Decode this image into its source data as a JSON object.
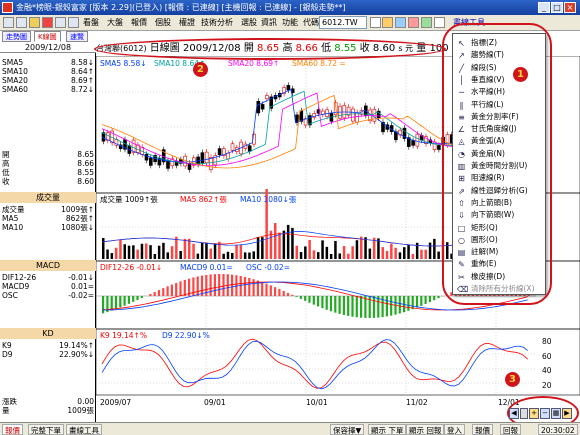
{
  "window": {
    "title": "金融*榜眼-銀殼富家 [版本 2.29](已登入) [報價 : 已連線] [主機回報 : 已連線] - [銀殼走勢**]",
    "buttons": [
      "_",
      "□",
      "×"
    ]
  },
  "menubar": {
    "items": [
      "看盤",
      "大盤",
      "報價",
      "個股",
      "權證",
      "技術分析",
      "選股",
      "資訊",
      "功能"
    ],
    "code_label": "代碼",
    "code_value": "6012.TW",
    "drawtool_label": "畫線工具"
  },
  "tabs": [
    "走勢圖",
    "K線圖",
    "速覽"
  ],
  "left_panel": {
    "date": "2009/12/08",
    "ma_rows": [
      {
        "label": "SMA5",
        "value": "8.58",
        "arrow": "↓",
        "color": "#0040ff"
      },
      {
        "label": "SMA10",
        "value": "8.64",
        "arrow": "↑",
        "color": "#00a0a0"
      },
      {
        "label": "SMA20",
        "value": "8.69",
        "arrow": "↑",
        "color": "#ff00ff"
      },
      {
        "label": "SMA60",
        "value": "8.72",
        "arrow": "↓",
        "color": "#ff8000"
      }
    ],
    "ohlc": [
      {
        "label": "開",
        "value": "8.65"
      },
      {
        "label": "高",
        "value": "8.66"
      },
      {
        "label": "低",
        "value": "8.55"
      },
      {
        "label": "收",
        "value": "8.60"
      }
    ],
    "volume_head": "成交量",
    "volume_rows": [
      {
        "label": "成交量",
        "value": "1009張",
        "arrow": "↑",
        "color": "#000000"
      },
      {
        "label": "MA5",
        "value": "862張",
        "arrow": "↑",
        "color": "#ff0000"
      },
      {
        "label": "MA10",
        "value": "1080張",
        "arrow": "↓",
        "color": "#0040ff"
      }
    ],
    "macd_head": "MACD",
    "macd_rows": [
      {
        "label": "DIF12-26",
        "value": "-0.01",
        "arrow": "↓",
        "color": "#ff0000"
      },
      {
        "label": "MACD9",
        "value": "0.01",
        "arrow": "=",
        "color": "#0040ff"
      },
      {
        "label": "OSC",
        "value": "-0.02",
        "arrow": "=",
        "color": "#0040ff"
      }
    ],
    "kd_head": "KD",
    "kd_rows": [
      {
        "label": "K9",
        "value": "19.14%",
        "arrow": "↑",
        "color": "#ff0000"
      },
      {
        "label": "D9",
        "value": "22.90%",
        "arrow": "↓",
        "color": "#0040ff"
      }
    ],
    "bottom_rows": [
      {
        "label": "漲跌",
        "value": "0.00"
      },
      {
        "label": "量",
        "value": "1009張"
      }
    ]
  },
  "stock_bar": {
    "name": "台灣聯(6012)",
    "period": "日線圖",
    "date": "2009/12/08",
    "open_label": "開",
    "open": "8.65",
    "high_label": "高",
    "high": "8.66",
    "low_label": "低",
    "low": "8.55",
    "close_label": "收",
    "close": "8.60",
    "unit": "s 元",
    "volume_label": "量",
    "volume": "100"
  },
  "chart": {
    "price_legend": [
      {
        "text": "SMA5 8.58↓",
        "color": "#0040ff"
      },
      {
        "text": "SMA10 8.64↑",
        "color": "#00a0a0"
      },
      {
        "text": "SMA20 8.69↑",
        "color": "#ff00ff"
      },
      {
        "text": "SMA60 8.72 =",
        "color": "#ff8000"
      }
    ],
    "volume_legend": [
      {
        "text": "成交量 1009↑張",
        "color": "#000000"
      },
      {
        "text": "MA5 862↑張",
        "color": "#ff0000"
      },
      {
        "text": "MA10 1080↓張",
        "color": "#0040ff"
      }
    ],
    "macd_legend": [
      {
        "text": "DIF12-26 -0.01↓",
        "color": "#ff0000"
      },
      {
        "text": "MACD9 0.01=",
        "color": "#0040ff"
      },
      {
        "text": "OSC -0.02=",
        "color": "#0040ff"
      }
    ],
    "kd_legend": [
      {
        "text": "K9 19.14↑%",
        "color": "#ff0000"
      },
      {
        "text": "D9 22.90↓%",
        "color": "#0040ff"
      }
    ],
    "kd_axis": [
      "80",
      "60",
      "40",
      "20"
    ],
    "x_labels": [
      "2009/07",
      "09/01",
      "10/01",
      "11/02",
      "12/01"
    ]
  },
  "popup_menu": {
    "title": "畫線工具",
    "items": [
      {
        "icon": "↖",
        "label": "指標(Z)",
        "disabled": false,
        "icon_name": "pointer-icon"
      },
      {
        "icon": "↗",
        "label": "趨勢線(T)",
        "disabled": false,
        "icon_name": "trendline-icon"
      },
      {
        "icon": "╱",
        "label": "線段(S)",
        "disabled": false,
        "icon_name": "segment-icon"
      },
      {
        "icon": "│",
        "label": "垂直線(V)",
        "disabled": false,
        "icon_name": "vertical-line-icon"
      },
      {
        "icon": "─",
        "label": "水平線(H)",
        "disabled": false,
        "icon_name": "horizontal-line-icon"
      },
      {
        "icon": "∥",
        "label": "平行線(L)",
        "disabled": false,
        "icon_name": "parallel-line-icon"
      },
      {
        "icon": "≡",
        "label": "黃金分割率(F)",
        "disabled": false,
        "icon_name": "fibonacci-icon"
      },
      {
        "icon": "∠",
        "label": "甘氏角度線(J)",
        "disabled": false,
        "icon_name": "gann-angle-icon"
      },
      {
        "icon": "◬",
        "label": "黃金弧(A)",
        "disabled": false,
        "icon_name": "golden-arc-icon"
      },
      {
        "icon": "◔",
        "label": "黃金扇(N)",
        "disabled": false,
        "icon_name": "golden-fan-icon"
      },
      {
        "icon": "▥",
        "label": "黃金時間分割(U)",
        "disabled": false,
        "icon_name": "golden-time-icon"
      },
      {
        "icon": "⊞",
        "label": "阻速線(R)",
        "disabled": false,
        "icon_name": "speed-resistance-icon"
      },
      {
        "icon": "⇗",
        "label": "線性迴歸分析(G)",
        "disabled": false,
        "icon_name": "regression-icon"
      },
      {
        "icon": "⇧",
        "label": "向上箭頭(B)",
        "disabled": false,
        "icon_name": "arrow-up-icon"
      },
      {
        "icon": "⇩",
        "label": "向下箭頭(W)",
        "disabled": false,
        "icon_name": "arrow-down-icon"
      },
      {
        "icon": "□",
        "label": "矩形(Q)",
        "disabled": false,
        "icon_name": "rectangle-icon"
      },
      {
        "icon": "○",
        "label": "圓形(O)",
        "disabled": false,
        "icon_name": "circle-icon"
      },
      {
        "icon": "▤",
        "label": "註解(M)",
        "disabled": false,
        "icon_name": "note-icon"
      },
      {
        "icon": "✎",
        "label": "重佈(E)",
        "disabled": false,
        "icon_name": "redraw-icon"
      },
      {
        "icon": "✂",
        "label": "橡皮擦(D)",
        "disabled": false,
        "icon_name": "eraser-icon"
      },
      {
        "icon": "⌫",
        "label": "清除所有分析線(X)",
        "disabled": true,
        "icon_name": "clear-all-icon"
      }
    ]
  },
  "annotations": [
    "1",
    "2",
    "3"
  ],
  "statusbar": {
    "left_tab": "報價",
    "tabs": [
      "完整下單",
      "畫線工具"
    ],
    "items": [
      "保容擇▼",
      "顯示 下單",
      "顯示 回報",
      "登入",
      "報價",
      "回報"
    ],
    "time": "20:30:02"
  }
}
